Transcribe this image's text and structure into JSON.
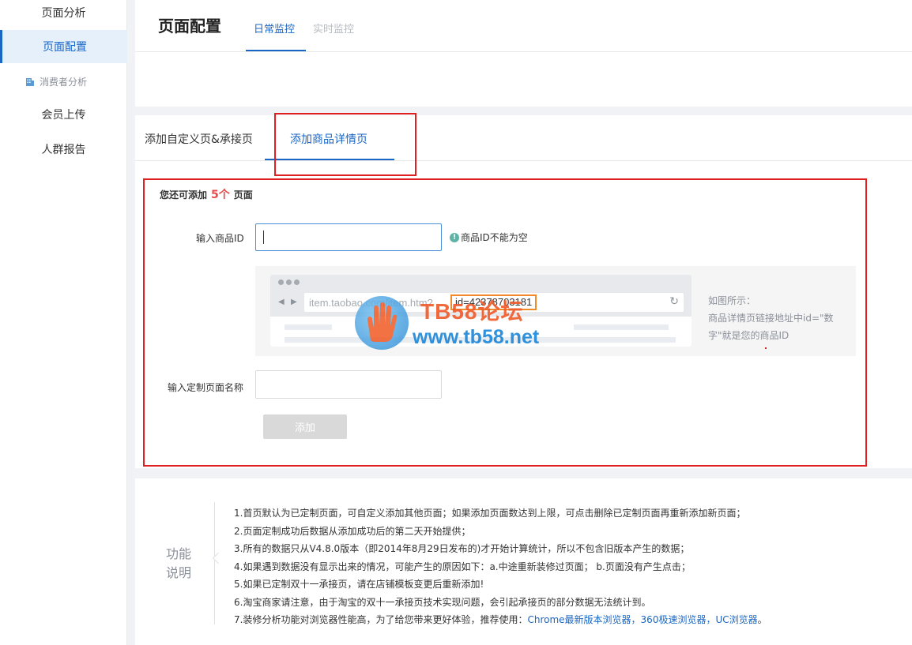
{
  "sidebar": {
    "items": [
      {
        "label": "页面分析"
      },
      {
        "label": "页面配置"
      },
      {
        "label": "消费者分析"
      },
      {
        "label": "会员上传"
      },
      {
        "label": "人群报告"
      }
    ]
  },
  "header": {
    "title": "页面配置",
    "tabs": [
      {
        "label": "日常监控"
      },
      {
        "label": "实时监控"
      }
    ]
  },
  "main": {
    "tabs": [
      {
        "label": "添加自定义页&承接页"
      },
      {
        "label": "添加商品详情页"
      }
    ],
    "quota": {
      "prefix": "您还可添加",
      "count": "5个",
      "suffix": "页面"
    },
    "product_id": {
      "label": "输入商品ID",
      "value": "",
      "warning": "商品ID不能为空"
    },
    "illustration": {
      "url": "item.taobao.com/item.htm?",
      "id_text": "id=42378703181",
      "note_line1": "如图所示：",
      "note_line2": "商品详情页链接地址中id=\"数字\"就是您的商品ID"
    },
    "page_name": {
      "label": "输入定制页面名称",
      "value": ""
    },
    "add_button": "添加"
  },
  "watermark": {
    "line1": "TB58论坛",
    "line2": "www.tb58.net"
  },
  "notes": {
    "title": "功能说明",
    "items": [
      "1.首页默认为已定制页面，可自定义添加其他页面；如果添加页面数达到上限，可点击删除已定制页面再重新添加新页面；",
      "2.页面定制成功后数据从添加成功后的第二天开始提供；",
      "3.所有的数据只从V4.8.0版本（即2014年8月29日发布的)才开始计算统计，所以不包含旧版本产生的数据；",
      "4.如果遇到数据没有显示出来的情况，可能产生的原因如下：a.中途重新装修过页面； b.页面没有产生点击；",
      "5.如果已定制双十一承接页，请在店铺模板变更后重新添加!",
      "6.淘宝商家请注意，由于淘宝的双十一承接页技术实现问题，会引起承接页的部分数据无法统计到。"
    ],
    "last": {
      "prefix": "7.装修分析功能对浏览器性能高，为了给您带来更好体验，推荐使用：",
      "link1": "Chrome最新版本浏览器",
      "sep1": "，",
      "link2": "360极速浏览器",
      "sep2": "，",
      "link3": "UC浏览器",
      "end": "。"
    }
  },
  "colors": {
    "accent": "#1a66c4",
    "highlight_box": "#e02020",
    "quota_num": "#e84a4a",
    "id_box": "#f08a2b"
  }
}
